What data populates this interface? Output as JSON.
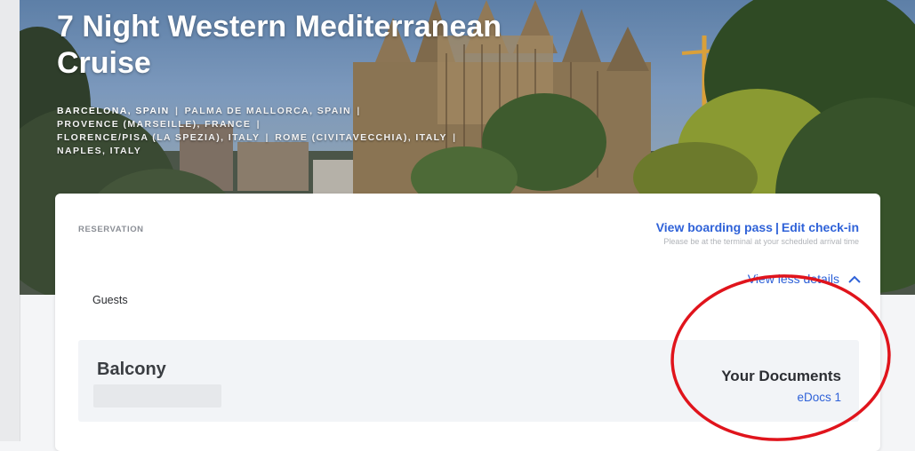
{
  "hero": {
    "title": "7 Night Western Mediterranean Cruise",
    "ports": [
      "BARCELONA, SPAIN",
      "PALMA DE MALLORCA, SPAIN",
      "PROVENCE (MARSEILLE), FRANCE",
      "FLORENCE/PISA (LA SPEZIA), ITALY",
      "ROME (CIVITAVECCHIA), ITALY",
      "NAPLES, ITALY"
    ],
    "separator": "|"
  },
  "reservation": {
    "label": "RESERVATION",
    "view_boarding_pass": "View boarding pass",
    "link_separator": "|",
    "edit_check_in": "Edit check-in",
    "terminal_note": "Please be at the terminal at your scheduled arrival time"
  },
  "guests": {
    "label": "Guests",
    "toggle_label": "View less details"
  },
  "cabin": {
    "type": "Balcony",
    "documents_title": "Your Documents",
    "edocs_label": "eDocs 1"
  },
  "colors": {
    "link": "#2f62d8",
    "annotation": "#e0141c"
  }
}
